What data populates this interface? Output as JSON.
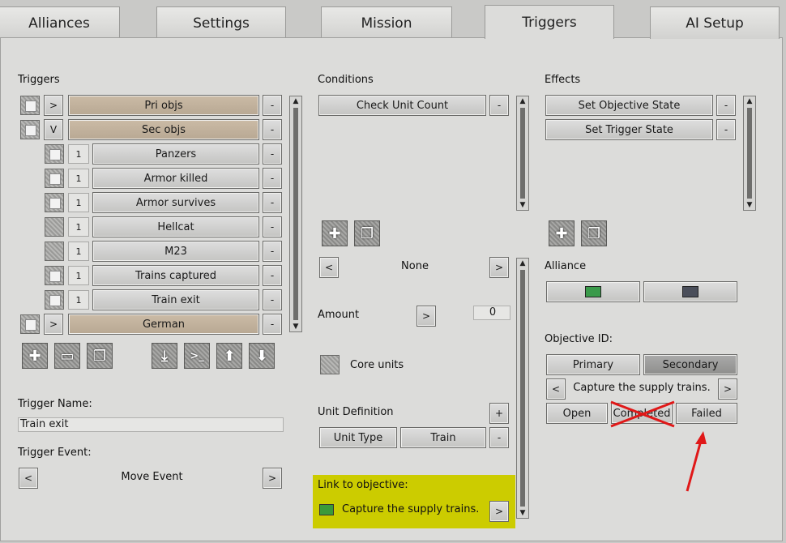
{
  "tabs": [
    {
      "label": "Alliances"
    },
    {
      "label": "Settings"
    },
    {
      "label": "Mission"
    },
    {
      "label": "Triggers"
    },
    {
      "label": "AI Setup"
    }
  ],
  "triggers": {
    "title": "Triggers",
    "rows": [
      {
        "expand": ">",
        "num": "",
        "label": "Pri objs",
        "checked": true
      },
      {
        "expand": "V",
        "num": "",
        "label": "Sec objs",
        "checked": true
      },
      {
        "expand": "",
        "num": "1",
        "label": "Panzers",
        "checked": true
      },
      {
        "expand": "",
        "num": "1",
        "label": "Armor killed",
        "checked": true
      },
      {
        "expand": "",
        "num": "1",
        "label": "Armor survives",
        "checked": true
      },
      {
        "expand": "",
        "num": "1",
        "label": "Hellcat",
        "checked": false
      },
      {
        "expand": "",
        "num": "1",
        "label": "M23",
        "checked": false
      },
      {
        "expand": "",
        "num": "1",
        "label": "Trains captured",
        "checked": true
      },
      {
        "expand": "",
        "num": "1",
        "label": "Train exit",
        "checked": true
      },
      {
        "expand": ">",
        "num": "",
        "label": "German",
        "checked": true
      }
    ],
    "minus": "-",
    "icons": [
      "plus-icon",
      "folder-icon",
      "copy-icon",
      "import-icon",
      "console-icon",
      "up-arrow-icon",
      "down-arrow-icon"
    ],
    "name_label": "Trigger Name:",
    "name_value": "Train exit",
    "event_label": "Trigger Event:",
    "event_value": "Move Event",
    "prev": "<",
    "next": ">"
  },
  "conditions": {
    "title": "Conditions",
    "items": [
      "Check Unit Count"
    ],
    "selector_value": "None",
    "amount_label": "Amount",
    "amount_value": "0",
    "core_units_label": "Core units",
    "unit_def_label": "Unit Definition",
    "plus": "+",
    "unit_type": "Unit Type",
    "unit_value": "Train",
    "link_label": "Link to objective:",
    "link_value": "Capture the supply trains.",
    "highlight_color": "#cccc00"
  },
  "effects": {
    "title": "Effects",
    "items": [
      "Set Objective State",
      "Set Trigger State"
    ],
    "alliance_label": "Alliance",
    "alliance_colors": [
      "#3a9a4a",
      "#4a4e5a"
    ],
    "objective_label": "Objective ID:",
    "primary": "Primary",
    "secondary": "Secondary",
    "objective_value": "Capture the supply trains.",
    "open": "Open",
    "completed": "Completed",
    "failed": "Failed"
  }
}
